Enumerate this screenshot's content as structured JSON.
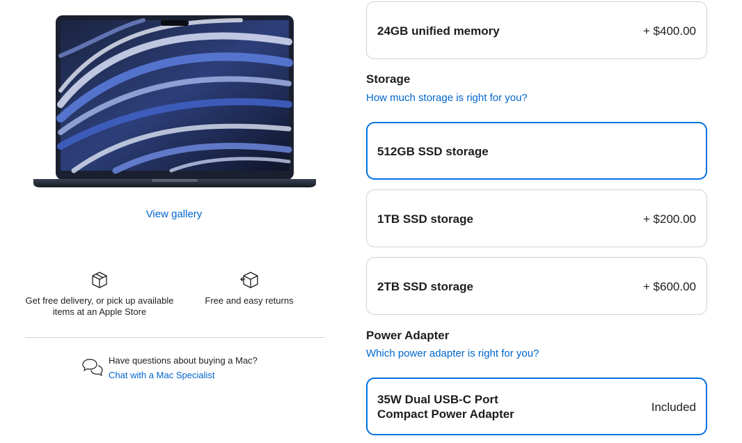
{
  "left": {
    "view_gallery": "View gallery",
    "delivery_text": "Get free delivery, or pick up available items at an Apple Store",
    "returns_text": "Free and easy returns",
    "help_question": "Have questions about buying a Mac?",
    "help_link": "Chat with a Mac Specialist"
  },
  "memory": {
    "option": {
      "name": "24GB unified memory",
      "price": "+ $400.00"
    }
  },
  "storage": {
    "title": "Storage",
    "help_link": "How much storage is right for you?",
    "options": [
      {
        "name": "512GB SSD storage",
        "price": "",
        "selected": true
      },
      {
        "name": "1TB SSD storage",
        "price": "+ $200.00",
        "selected": false
      },
      {
        "name": "2TB SSD storage",
        "price": "+ $600.00",
        "selected": false
      }
    ]
  },
  "power_adapter": {
    "title": "Power Adapter",
    "help_link": "Which power adapter is right for you?",
    "option": {
      "name_line1": "35W Dual USB-C Port",
      "name_line2": "Compact Power Adapter",
      "price": "Included",
      "selected": true
    }
  },
  "colors": {
    "accent": "#0071e3",
    "link": "#0066cc",
    "border": "#d2d2d7",
    "text": "#1d1d1f"
  },
  "icons": [
    "box-icon",
    "box-return-icon",
    "chat-bubbles-icon"
  ]
}
